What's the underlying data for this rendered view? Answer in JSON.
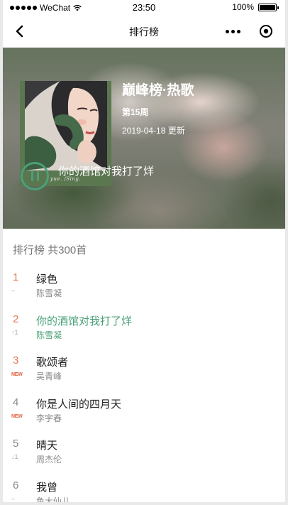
{
  "status_bar": {
    "carrier": "WeChat",
    "time": "23:50",
    "battery": "100%"
  },
  "nav": {
    "title": "排行榜"
  },
  "header": {
    "title": "巅峰榜·热歌",
    "week": "第15周",
    "date": "2019-04-18 更新",
    "now_playing": "你的酒馆对我打了烊",
    "cover_caption": "yue. /Sing."
  },
  "section": {
    "heading": "排行榜 共300首"
  },
  "songs": [
    {
      "rank": "1",
      "trend": "–",
      "title": "绿色",
      "artist": "陈雪凝"
    },
    {
      "rank": "2",
      "trend": "↑1",
      "title": "你的酒馆对我打了烊",
      "artist": "陈雪凝"
    },
    {
      "rank": "3",
      "trend": "NEW",
      "title": "歌颂者",
      "artist": "吴青峰"
    },
    {
      "rank": "4",
      "trend": "NEW",
      "title": "你是人间的四月天",
      "artist": "李宇春"
    },
    {
      "rank": "5",
      "trend": "↓1",
      "title": "晴天",
      "artist": "周杰伦"
    },
    {
      "rank": "6",
      "trend": "–",
      "title": "我曾",
      "artist": "鱼大仙儿"
    }
  ],
  "colors": {
    "accent": "#4aa078",
    "rank_top": "#e07a52",
    "rank_other": "#888888"
  }
}
